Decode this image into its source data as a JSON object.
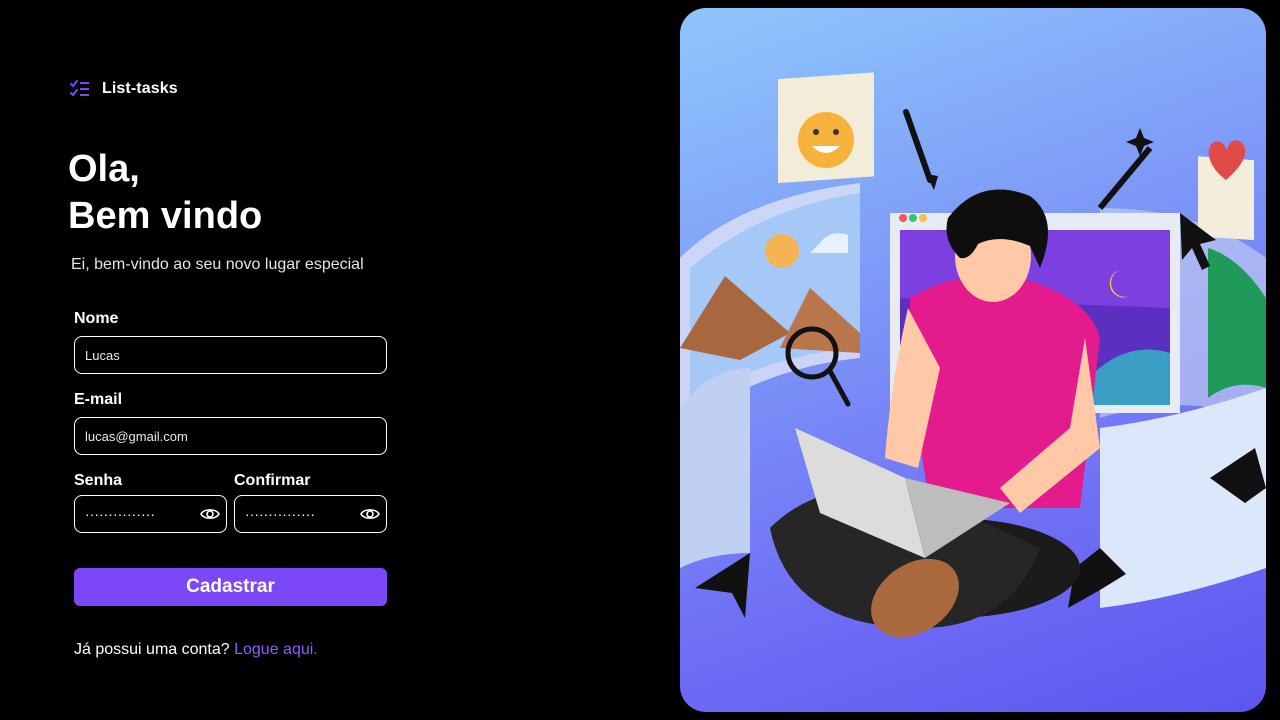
{
  "brand": {
    "name": "List-tasks",
    "icon": "checklist-icon",
    "accent": "#7c47f7"
  },
  "greeting": {
    "line1": "Ola,",
    "line2": "Bem vindo"
  },
  "subtitle": "Ei, bem-vindo ao seu novo lugar especial",
  "form": {
    "name": {
      "label": "Nome",
      "value": "Lucas"
    },
    "email": {
      "label": "E-mail",
      "value": "lucas@gmail.com"
    },
    "password": {
      "label": "Senha",
      "value": "···············"
    },
    "confirm": {
      "label": "Confirmar",
      "value": "···············"
    },
    "submit": "Cadastrar"
  },
  "footer": {
    "prompt": "Já possui uma conta?",
    "link": "Logue aqui."
  },
  "illustration": {
    "icon": "person-with-laptop-illustration"
  }
}
